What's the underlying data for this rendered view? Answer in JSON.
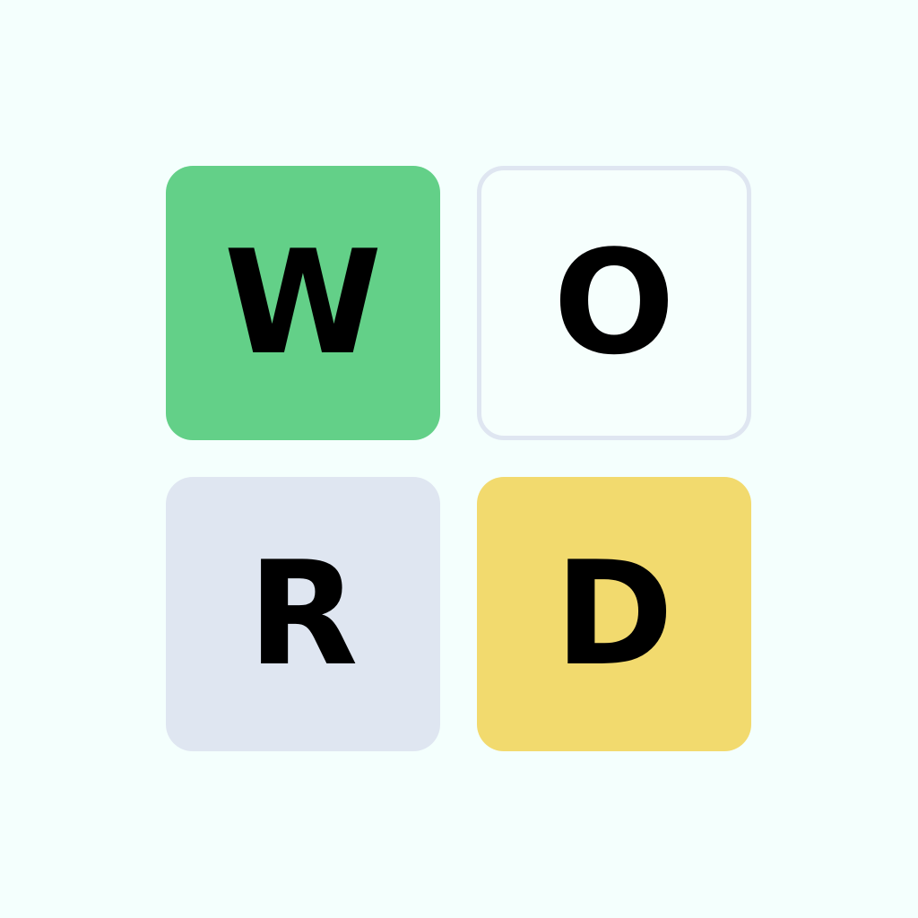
{
  "board": {
    "tiles": [
      {
        "letter": "W",
        "state": "correct",
        "color": "#63d088"
      },
      {
        "letter": "O",
        "state": "empty",
        "color": "#f6fffd",
        "border_color": "#dfe6f1"
      },
      {
        "letter": "R",
        "state": "absent",
        "color": "#dfe6f1"
      },
      {
        "letter": "D",
        "state": "present",
        "color": "#f2da6e"
      }
    ]
  },
  "colors": {
    "background": "#f4fffd",
    "letter": "#000000"
  }
}
